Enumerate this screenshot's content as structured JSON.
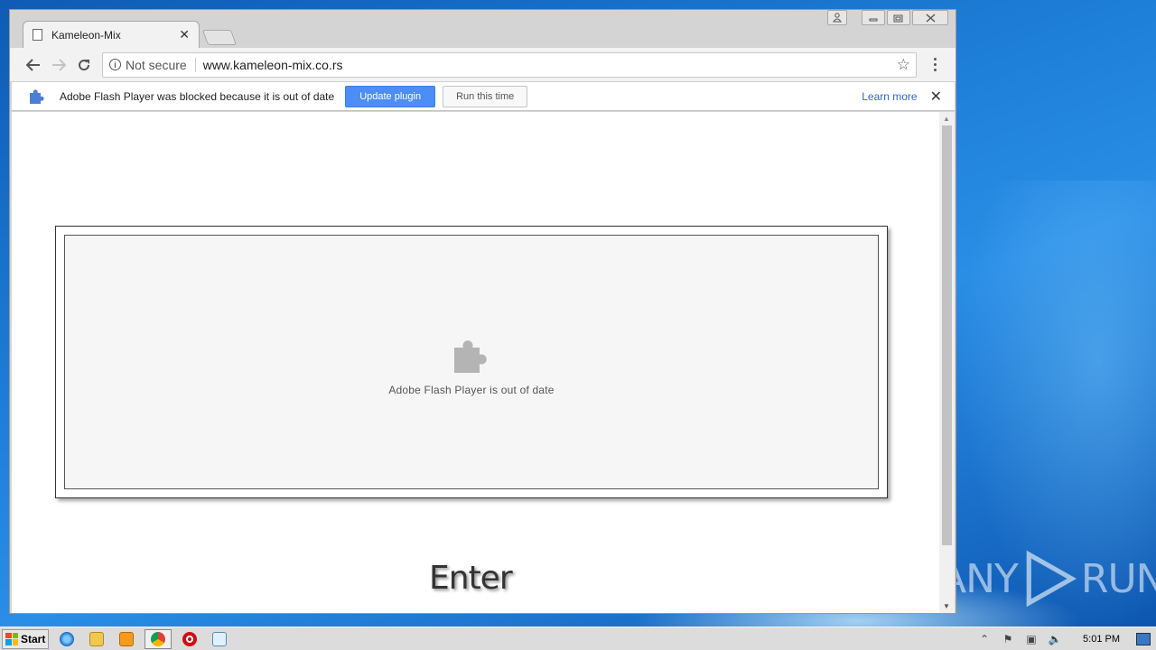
{
  "browser": {
    "tab_title": "Kameleon-Mix",
    "security_label": "Not secure",
    "url": "www.kameleon-mix.co.rs"
  },
  "infobar": {
    "message": "Adobe Flash Player was blocked because it is out of date",
    "update_button": "Update plugin",
    "run_button": "Run this time",
    "learn_more": "Learn more"
  },
  "page": {
    "plugin_message": "Adobe Flash Player is out of date",
    "enter_label": "Enter"
  },
  "watermark": {
    "left": "ANY",
    "right": "RUN"
  },
  "taskbar": {
    "start_label": "Start",
    "clock": "5:01 PM"
  },
  "colors": {
    "accent_blue": "#4c8ef6",
    "link_blue": "#3366cc",
    "desktop_blue": "#1e7fd8"
  }
}
